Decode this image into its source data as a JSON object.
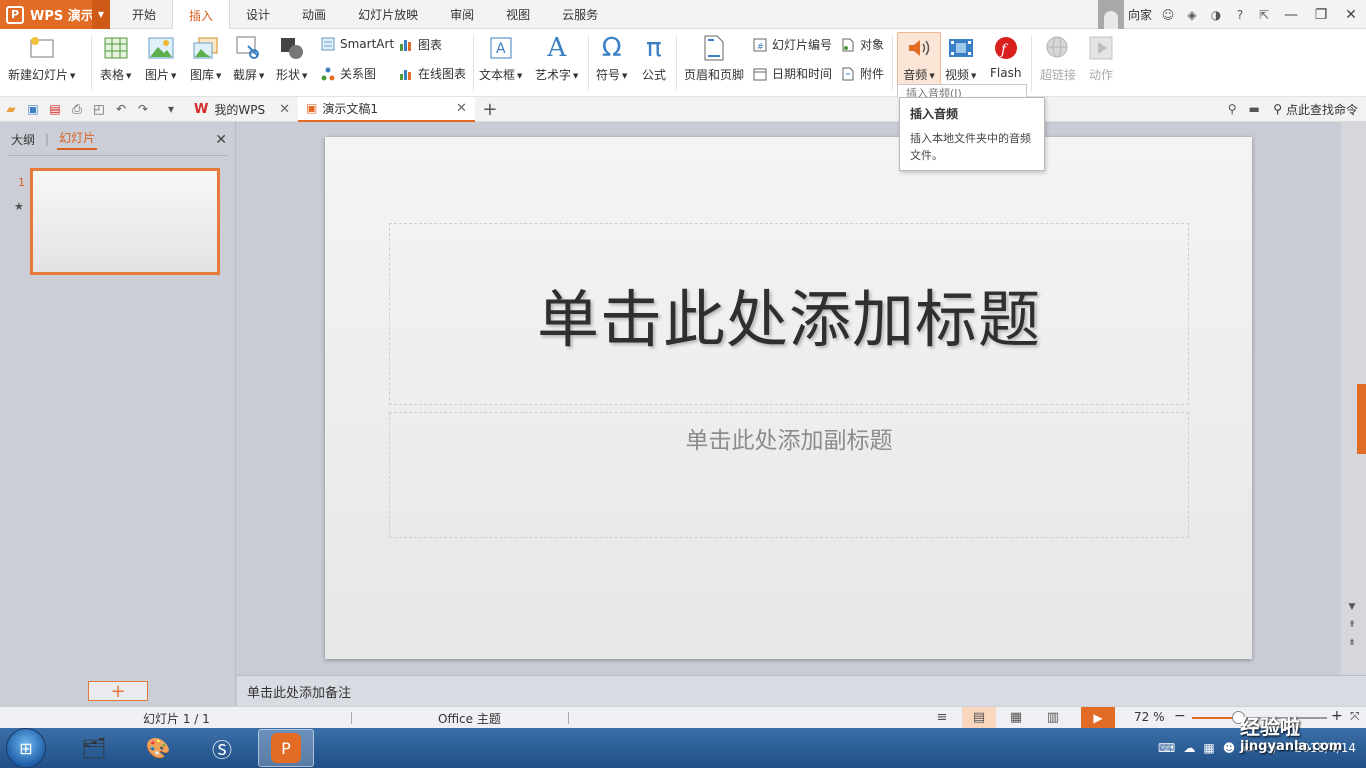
{
  "app": {
    "name": "WPS 演示"
  },
  "menu_tabs": [
    "开始",
    "插入",
    "设计",
    "动画",
    "幻灯片放映",
    "审阅",
    "视图",
    "云服务"
  ],
  "active_menu_tab": "插入",
  "user": {
    "name": "向家"
  },
  "ribbon": {
    "new_slide": "新建幻灯片",
    "table": "表格",
    "picture": "图片",
    "gallery": "图库",
    "screenshot": "截屏",
    "shape": "形状",
    "smartart": "SmartArt",
    "relation": "关系图",
    "chart": "图表",
    "online_chart": "在线图表",
    "textbox": "文本框",
    "wordart": "艺术字",
    "symbol": "符号",
    "formula": "公式",
    "header_footer": "页眉和页脚",
    "slide_number": "幻灯片编号",
    "object": "对象",
    "date_time": "日期和时间",
    "attachment": "附件",
    "audio": "音频",
    "video": "视频",
    "flash": "Flash",
    "hyperlink": "超链接",
    "action": "动作"
  },
  "doc_tabs": [
    {
      "label": "我的WPS"
    },
    {
      "label": "演示文稿1"
    }
  ],
  "search_command": "点此查找命令",
  "panel": {
    "outline_tab": "大纲",
    "slides_tab": "幻灯片",
    "slide_number": "1"
  },
  "slide": {
    "title_placeholder": "单击此处添加标题",
    "subtitle_placeholder": "单击此处添加副标题"
  },
  "notes_placeholder": "单击此处添加备注",
  "status": {
    "slide_info": "幻灯片 1 / 1",
    "theme": "Office 主题",
    "zoom": "72 %",
    "zoom_fraction": 0.32
  },
  "tooltip": {
    "peek": "插入音频(I)",
    "title": "插入音频",
    "description": "插入本地文件夹中的音频文件。"
  },
  "tray": {
    "date": "2018/4/14"
  },
  "watermark": {
    "line1": "经验啦",
    "line2": "jingyanla.com"
  },
  "colors": {
    "accent": "#e26b25",
    "accent_dark": "#d9601d"
  }
}
